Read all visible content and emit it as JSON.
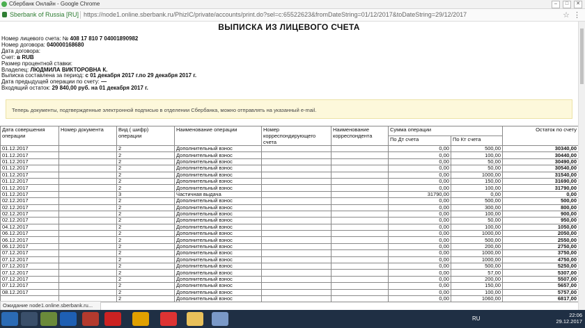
{
  "window": {
    "title": "Сбербанк Онлайн - Google Chrome",
    "secure_label": "Sberbank of Russia [RU]",
    "url": "https://node1.online.sberbank.ru/PhizIC/private/accounts/print.do?sel=c:65522623&fromDateString=01/12/2017&toDateString=29/12/2017"
  },
  "document": {
    "title": "ВЫПИСКА ИЗ ЛИЦЕВОГО СЧЕТА",
    "info": [
      {
        "label": "Номер лицевого счета: №",
        "value": "408 17 810 7 04001890982"
      },
      {
        "label": "Номер договора:",
        "value": "040000168680"
      },
      {
        "label": "Дата договора:",
        "value": ""
      },
      {
        "label": "Счет:",
        "value": "в RUB"
      },
      {
        "label": "Размер процентной ставки:",
        "value": ""
      },
      {
        "label": "Владелец:",
        "value": "ЛЮДМИЛА ВИКТОРОВНА К."
      },
      {
        "label": "Выписка составлена за период:",
        "value": "с 01 декабря 2017 г.по 29 декабря 2017 г."
      },
      {
        "label": "Дата предыдущей операции по счету:",
        "value": "—"
      },
      {
        "label": "Входящий остаток:",
        "value": "29 840,00 руб. на 01 декабря 2017 г."
      }
    ],
    "notice": "Теперь документы, подтвержденные электронной подписью в отделении Сбербанка, можно отправлять на указанный e-mail."
  },
  "table": {
    "headers": {
      "date": "Дата совершения операции",
      "doc_no": "Номер документа",
      "type": "Вид ( шифр) операции",
      "op_name": "Наименование операции",
      "corr_acc": "Номер корреспондирующего счета",
      "corr_name": "Наименование корреспондента",
      "sum": "Сумма операции",
      "debit": "По Дт счета",
      "credit": "По Кт счета",
      "balance": "Остаток по счету"
    },
    "rows": [
      {
        "date": "01.12.2017",
        "code": "2",
        "op": "Дополнительный взнос",
        "dt": "0,00",
        "kt": "500,00",
        "bal": "30340,00"
      },
      {
        "date": "01.12.2017",
        "code": "2",
        "op": "Дополнительный взнос",
        "dt": "0,00",
        "kt": "100,00",
        "bal": "30440,00"
      },
      {
        "date": "01.12.2017",
        "code": "2",
        "op": "Дополнительный взнос",
        "dt": "0,00",
        "kt": "50,00",
        "bal": "30490,00"
      },
      {
        "date": "01.12.2017",
        "code": "2",
        "op": "Дополнительный взнос",
        "dt": "0,00",
        "kt": "50,00",
        "bal": "30540,00"
      },
      {
        "date": "01.12.2017",
        "code": "2",
        "op": "Дополнительный взнос",
        "dt": "0,00",
        "kt": "1000,00",
        "bal": "31540,00"
      },
      {
        "date": "01.12.2017",
        "code": "2",
        "op": "Дополнительный взнос",
        "dt": "0,00",
        "kt": "150,00",
        "bal": "31690,00"
      },
      {
        "date": "01.12.2017",
        "code": "2",
        "op": "Дополнительный взнос",
        "dt": "0,00",
        "kt": "100,00",
        "bal": "31790,00"
      },
      {
        "date": "01.12.2017",
        "code": "3",
        "op": "Частичная выдача",
        "dt": "31790,00",
        "kt": "0,00",
        "bal": "0,00"
      },
      {
        "date": "02.12.2017",
        "code": "2",
        "op": "Дополнительный взнос",
        "dt": "0,00",
        "kt": "500,00",
        "bal": "500,00"
      },
      {
        "date": "02.12.2017",
        "code": "2",
        "op": "Дополнительный взнос",
        "dt": "0,00",
        "kt": "300,00",
        "bal": "800,00"
      },
      {
        "date": "02.12.2017",
        "code": "2",
        "op": "Дополнительный взнос",
        "dt": "0,00",
        "kt": "100,00",
        "bal": "900,00"
      },
      {
        "date": "02.12.2017",
        "code": "2",
        "op": "Дополнительный взнос",
        "dt": "0,00",
        "kt": "50,00",
        "bal": "950,00"
      },
      {
        "date": "04.12.2017",
        "code": "2",
        "op": "Дополнительный взнос",
        "dt": "0,00",
        "kt": "100,00",
        "bal": "1050,00"
      },
      {
        "date": "06.12.2017",
        "code": "2",
        "op": "Дополнительный взнос",
        "dt": "0,00",
        "kt": "1000,00",
        "bal": "2050,00"
      },
      {
        "date": "06.12.2017",
        "code": "2",
        "op": "Дополнительный взнос",
        "dt": "0,00",
        "kt": "500,00",
        "bal": "2550,00"
      },
      {
        "date": "06.12.2017",
        "code": "2",
        "op": "Дополнительный взнос",
        "dt": "0,00",
        "kt": "200,00",
        "bal": "2750,00"
      },
      {
        "date": "07.12.2017",
        "code": "2",
        "op": "Дополнительный взнос",
        "dt": "0,00",
        "kt": "1000,00",
        "bal": "3750,00"
      },
      {
        "date": "07.12.2017",
        "code": "2",
        "op": "Дополнительный взнос",
        "dt": "0,00",
        "kt": "1000,00",
        "bal": "4750,00"
      },
      {
        "date": "07.12.2017",
        "code": "2",
        "op": "Дополнительный взнос",
        "dt": "0,00",
        "kt": "500,00",
        "bal": "5250,00"
      },
      {
        "date": "07.12.2017",
        "code": "2",
        "op": "Дополнительный взнос",
        "dt": "0,00",
        "kt": "57,00",
        "bal": "5307,00"
      },
      {
        "date": "07.12.2017",
        "code": "2",
        "op": "Дополнительный взнос",
        "dt": "0,00",
        "kt": "200,00",
        "bal": "5507,00"
      },
      {
        "date": "07.12.2017",
        "code": "2",
        "op": "Дополнительный взнос",
        "dt": "0,00",
        "kt": "150,00",
        "bal": "5657,00"
      },
      {
        "date": "08.12.2017",
        "code": "2",
        "op": "Дополнительный взнос",
        "dt": "0,00",
        "kt": "100,00",
        "bal": "5757,00"
      },
      {
        "date": "",
        "code": "2",
        "op": "Дополнительный взнос",
        "dt": "0,00",
        "kt": "1060,00",
        "bal": "6817,00"
      }
    ]
  },
  "status": "Ожидание node1.online.sberbank.ru...",
  "taskbar": {
    "lang": "RU",
    "time": "22:06",
    "date": "29.12.2017"
  }
}
